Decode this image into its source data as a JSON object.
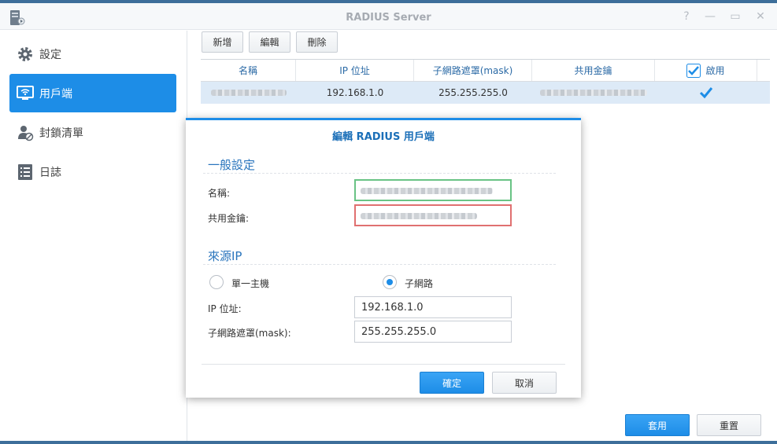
{
  "window": {
    "title": "RADIUS Server",
    "controls": [
      "?",
      "—",
      "▭",
      "✕"
    ]
  },
  "sidebar": {
    "items": [
      {
        "label": "設定",
        "icon": "gear-icon",
        "active": false
      },
      {
        "label": "用戶端",
        "icon": "monitor-wifi-icon",
        "active": true
      },
      {
        "label": "封鎖清單",
        "icon": "user-block-icon",
        "active": false
      },
      {
        "label": "日誌",
        "icon": "list-icon",
        "active": false
      }
    ]
  },
  "toolbar": {
    "add_label": "新增",
    "edit_label": "編輯",
    "delete_label": "刪除"
  },
  "table": {
    "columns": [
      "名稱",
      "IP 位址",
      "子網路遮罩(mask)",
      "共用金鑰",
      "啟用"
    ],
    "rows": [
      {
        "name": "[redacted]",
        "ip": "192.168.1.0",
        "mask": "255.255.255.0",
        "key": "[redacted]",
        "enabled": true
      }
    ]
  },
  "dialog": {
    "title": "編輯 RADIUS 用戶端",
    "general_section": "一般設定",
    "name_label": "名稱:",
    "key_label": "共用金鑰:",
    "source_section": "來源IP",
    "radio_single": "單一主機",
    "radio_subnet": "子網路",
    "selected_mode": "subnet",
    "ip_label": "IP 位址:",
    "ip_value": "192.168.1.0",
    "mask_label": "子網路遮罩(mask):",
    "mask_value": "255.255.255.0",
    "ok_label": "確定",
    "cancel_label": "取消"
  },
  "footer": {
    "apply_label": "套用",
    "reset_label": "重置"
  },
  "colors": {
    "accent": "#1d8de7",
    "header_text": "#2b6aa6",
    "selected_row": "#ddeaf7"
  }
}
